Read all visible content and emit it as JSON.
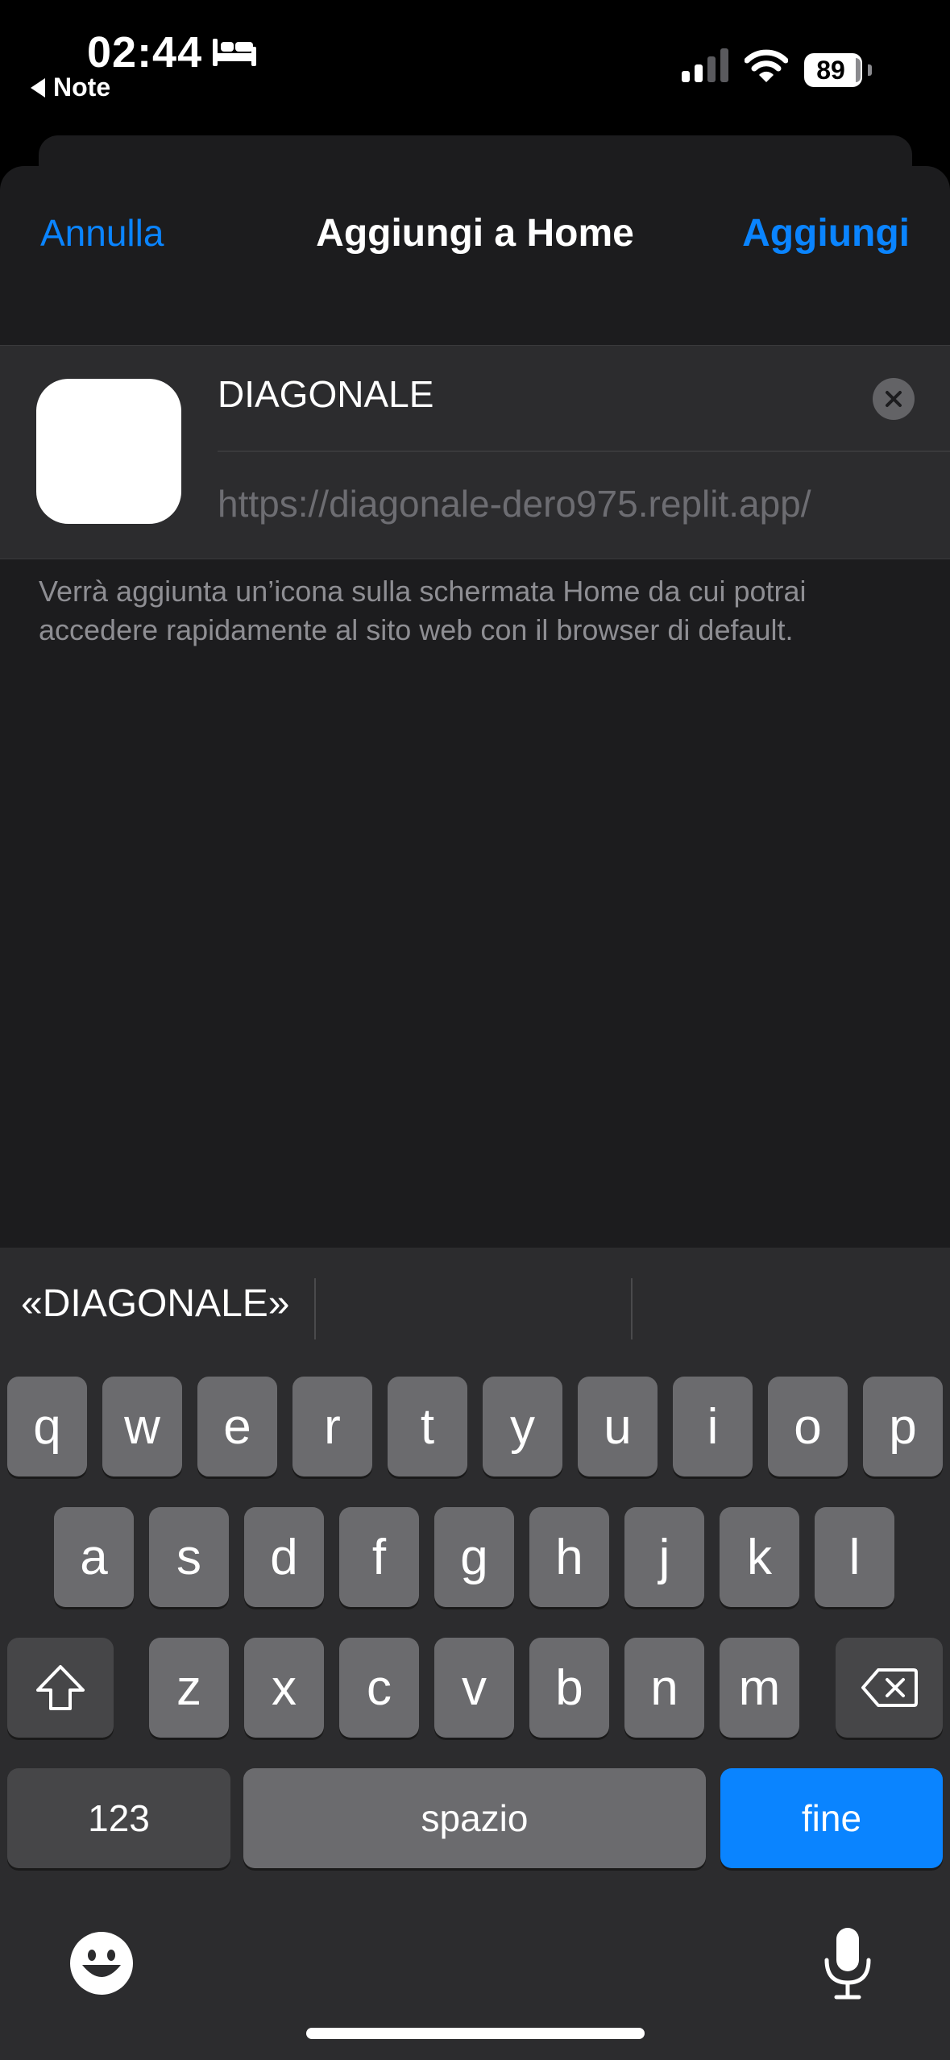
{
  "status": {
    "time": "02:44",
    "back_app": "Note",
    "battery": "89"
  },
  "nav": {
    "cancel": "Annulla",
    "title": "Aggiungi a Home",
    "add": "Aggiungi"
  },
  "form": {
    "name_value": "DIAGONALE",
    "url": "https://diagonale-dero975.replit.app/",
    "info": "Verrà aggiunta un’icona sulla schermata Home da cui potrai accedere rapidamente al sito web con il browser di default."
  },
  "keyboard": {
    "suggestions": [
      "«DIAGONALE»",
      "",
      ""
    ],
    "row1": [
      "q",
      "w",
      "e",
      "r",
      "t",
      "y",
      "u",
      "i",
      "o",
      "p"
    ],
    "row2": [
      "a",
      "s",
      "d",
      "f",
      "g",
      "h",
      "j",
      "k",
      "l"
    ],
    "row3": [
      "z",
      "x",
      "c",
      "v",
      "b",
      "n",
      "m"
    ],
    "numbers_label": "123",
    "space_label": "spazio",
    "done_label": "fine"
  },
  "icons": [
    "bed-icon",
    "signal-icon",
    "wifi-icon",
    "battery-icon",
    "clear-icon",
    "shift-icon",
    "backspace-icon",
    "emoji-icon",
    "microphone-icon"
  ],
  "colors": {
    "accent": "#0a84ff",
    "sheet": "#1c1c1e",
    "keyboard": "#2c2c2e"
  }
}
